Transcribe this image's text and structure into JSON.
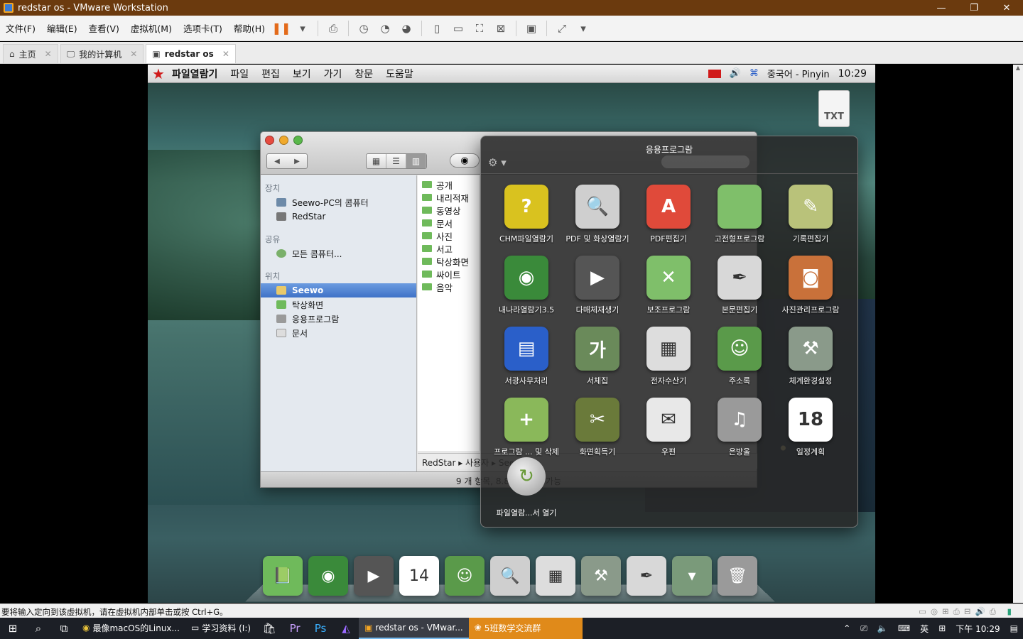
{
  "window": {
    "title": "redstar os - VMware Workstation",
    "minimize": "—",
    "restore": "❐",
    "close": "✕"
  },
  "menubar": {
    "items": [
      "文件(F)",
      "编辑(E)",
      "查看(V)",
      "虚拟机(M)",
      "选项卡(T)",
      "帮助(H)"
    ]
  },
  "tabs": [
    {
      "label": "主页",
      "icon": "⌂"
    },
    {
      "label": "我的计算机",
      "icon": "🖵"
    },
    {
      "label": "redstar os",
      "icon": "▣"
    }
  ],
  "redstar": {
    "menu": [
      "파일열람기",
      "파일",
      "편집",
      "보기",
      "가기",
      "창문",
      "도움말"
    ],
    "input_method": "중국어 - Pinyin",
    "clock": "10:29",
    "desktop_file": "TXT"
  },
  "finder": {
    "sidebar": {
      "devices_header": "장치",
      "devices": [
        "Seewo-PC의 콤퓨터",
        "RedStar"
      ],
      "shared_header": "공유",
      "shared": [
        "모든 콤퓨터..."
      ],
      "places_header": "위치",
      "places": [
        "Seewo",
        "탁상화면",
        "응용프로그람",
        "문서"
      ]
    },
    "folders": [
      "공개",
      "내리적재",
      "동영상",
      "문서",
      "사진",
      "서고",
      "탁상화면",
      "싸이트",
      "음악"
    ],
    "path": "RedStar ▸ 사용자 ▸ Seewo",
    "status": "9 개 항목, 8.8 GB 사용 가능"
  },
  "stack": {
    "title": "응용프로그람",
    "apps": [
      {
        "label": "CHM파일열람기",
        "icon": "?",
        "color": "#d9c21f"
      },
      {
        "label": "PDF 및 화상열람기",
        "icon": "🔍",
        "color": "#cfcfcf"
      },
      {
        "label": "PDF편집기",
        "icon": "A",
        "color": "#e04a3a"
      },
      {
        "label": "고전형프로그람",
        "icon": "",
        "color": "#7fbf6a"
      },
      {
        "label": "기록편집기",
        "icon": "✎",
        "color": "#b9c27a"
      },
      {
        "label": "내나라열람기3.5",
        "icon": "◉",
        "color": "#3a8a3a"
      },
      {
        "label": "다매체재생기",
        "icon": "▶",
        "color": "#555555"
      },
      {
        "label": "보조프로그람",
        "icon": "✕",
        "color": "#7fbf6a"
      },
      {
        "label": "본문편집기",
        "icon": "✒",
        "color": "#d8d8d8"
      },
      {
        "label": "사진관리프로그람",
        "icon": "◙",
        "color": "#c9713a"
      },
      {
        "label": "서광사무처리",
        "icon": "▤",
        "color": "#2a5fc9"
      },
      {
        "label": "서체집",
        "icon": "가",
        "color": "#6a8a5a"
      },
      {
        "label": "전자수산기",
        "icon": "▦",
        "color": "#dddddd"
      },
      {
        "label": "주소록",
        "icon": "☺",
        "color": "#5a9a4a"
      },
      {
        "label": "체계환경설정",
        "icon": "⚒",
        "color": "#8a9a8a"
      },
      {
        "label": "프로그람 ... 및 삭제",
        "icon": "+",
        "color": "#8ab85a"
      },
      {
        "label": "화면획득기",
        "icon": "✂",
        "color": "#6a7a3a"
      },
      {
        "label": "우편",
        "icon": "✉",
        "color": "#e8e8e8"
      },
      {
        "label": "은방울",
        "icon": "♫",
        "color": "#9a9a9a"
      },
      {
        "label": "일정계획",
        "icon": "18",
        "color": "#ffffff"
      }
    ],
    "open_label": "파일열람...서 열기"
  },
  "dock": [
    "📗",
    "◉",
    "▶",
    "14",
    "☺",
    "🔍",
    "▦",
    "⚒",
    "✒",
    "▾",
    "🗑"
  ],
  "vm_status": "要将输入定向到该虚拟机，请在虚拟机内部单击或按 Ctrl+G。",
  "taskbar": {
    "tasks": [
      {
        "label": "最像macOS的Linux..."
      },
      {
        "label": "学习资料 (I:)"
      },
      {
        "label": "redstar os - VMwar..."
      },
      {
        "label": "5班数学交流群"
      }
    ],
    "ime": "英",
    "time": "下午 10:29"
  }
}
